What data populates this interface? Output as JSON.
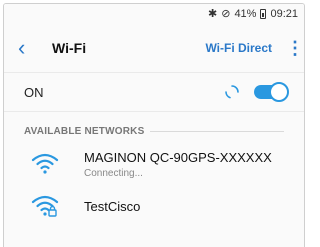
{
  "status": {
    "battery": "41%",
    "time": "09:21"
  },
  "header": {
    "title": "Wi-Fi",
    "wifi_direct": "Wi-Fi Direct"
  },
  "toggle_row": {
    "label": "ON",
    "enabled": true
  },
  "available": {
    "label": "AVAILABLE NETWORKS"
  },
  "networks": [
    {
      "name": "MAGINON QC-90GPS-XXXXXX",
      "status": "Connecting...",
      "secured": false
    },
    {
      "name": "TestCisco",
      "secured": true
    }
  ],
  "colors": {
    "accent": "#2a78c8",
    "toggle": "#2a98e0"
  }
}
